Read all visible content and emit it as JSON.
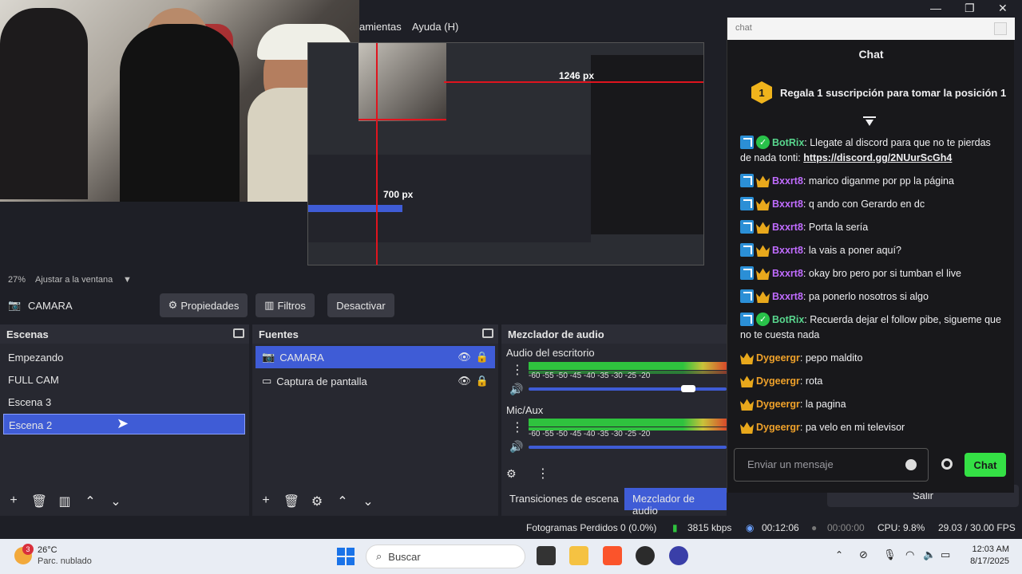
{
  "menu": {
    "partial_item": "amientas",
    "help": "Ayuda (H)"
  },
  "preview": {
    "label_w": "1246 px",
    "label_h": "700 px"
  },
  "zoom": {
    "percent": "27%",
    "mode": "Ajustar a la ventana"
  },
  "source_bar": {
    "current": "CAMARA",
    "properties": "Propiedades",
    "filters": "Filtros",
    "deactivate": "Desactivar"
  },
  "scenes": {
    "title": "Escenas",
    "items": [
      "Empezando",
      "FULL CAM",
      "Escena 3",
      "Escena 2"
    ],
    "selected": "Escena 2"
  },
  "sources": {
    "title": "Fuentes",
    "items": [
      "CAMARA",
      "Captura de pantalla"
    ]
  },
  "mixer": {
    "title": "Mezclador de audio",
    "channels": [
      {
        "name": "Audio del escritorio",
        "level": 0.8
      },
      {
        "name": "Mic/Aux",
        "level": 0.92
      }
    ],
    "ticks": "-60 -55 -50 -45 -40 -35 -30 -25 -20"
  },
  "bottom_tabs": {
    "transitions": "Transiciones de escena",
    "mixer": "Mezclador de audio"
  },
  "exit": "Salir",
  "status": {
    "dropped": "Fotogramas Perdidos 0 (0.0%)",
    "bitrate": "3815 kbps",
    "live_time": "00:12:06",
    "rec_time": "00:00:00",
    "cpu": "CPU: 9.8%",
    "fps": "29.03 / 30.00 FPS"
  },
  "chat": {
    "url_label": "chat",
    "title": "Chat",
    "pinned_rank": "1",
    "pinned": "Regala 1 suscripción para tomar la posición 1",
    "messages": [
      {
        "user": "BotRix",
        "text": ": Llegate al discord para que no te pierdas de nada tonti: ",
        "link": "https://discord.gg/2NUurScGh4"
      },
      {
        "user": "Bxxrt8",
        "text": ": marico diganme por pp la página"
      },
      {
        "user": "Bxxrt8",
        "text": ": q ando con Gerardo en dc"
      },
      {
        "user": "Bxxrt8",
        "text": ": Porta la sería"
      },
      {
        "user": "Bxxrt8",
        "text": ": la vais a poner aquí?"
      },
      {
        "user": "Bxxrt8",
        "text": ": okay bro pero por si tumban el live"
      },
      {
        "user": "Bxxrt8",
        "text": ": pa ponerlo nosotros si algo"
      },
      {
        "user": "BotRix",
        "text": ": Recuerda dejar el follow pibe, sigueme que no te cuesta nada"
      },
      {
        "user": "Dygeergr",
        "text": ": pepo maldito"
      },
      {
        "user": "Dygeergr",
        "text": ": rota"
      },
      {
        "user": "Dygeergr",
        "text": ": la pagina"
      },
      {
        "user": "Dygeergr",
        "text": ": pa velo en mi televisor"
      }
    ],
    "input_placeholder": "Enviar un mensaje",
    "send": "Chat"
  },
  "taskbar": {
    "weather_badge": "3",
    "weather_temp": "26°C",
    "weather_desc": "Parc. nublado",
    "search": "Buscar",
    "time": "12:03 AM",
    "date": "8/17/2025"
  }
}
